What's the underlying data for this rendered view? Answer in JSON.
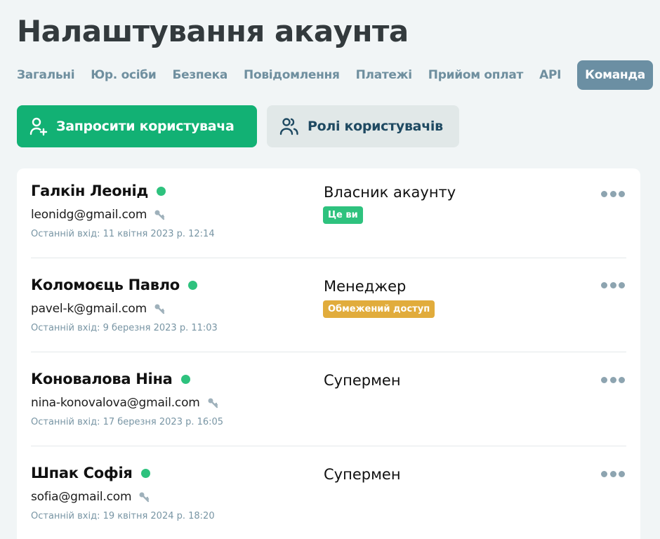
{
  "page": {
    "title": "Налаштування акаунта"
  },
  "tabs": [
    {
      "label": "Загальні",
      "active": false
    },
    {
      "label": "Юр. осіби",
      "active": false
    },
    {
      "label": "Безпека",
      "active": false
    },
    {
      "label": "Повідомлення",
      "active": false
    },
    {
      "label": "Платежі",
      "active": false
    },
    {
      "label": "Прийом оплат",
      "active": false
    },
    {
      "label": "API",
      "active": false
    },
    {
      "label": "Команда",
      "active": true
    }
  ],
  "actions": {
    "invite_label": "Запросити користувача",
    "invite_icon": "user-plus-icon",
    "roles_label": "Ролі користувачів",
    "roles_icon": "users-icon"
  },
  "colors": {
    "primary": "#12b174",
    "active_tab": "#6b8fa3",
    "online": "#2ec27e",
    "badge_self": "#2ec27e",
    "badge_limited": "#e1ac3c"
  },
  "members": [
    {
      "name": "Галкін Леонід",
      "online": true,
      "email": "leonidg@gmail.com",
      "last_login": "Останній вхід: 11 квітня 2023 р. 12:14",
      "role": "Власник акаунту",
      "badge": "Це ви",
      "badge_type": "green"
    },
    {
      "name": "Коломоєць Павло",
      "online": true,
      "email": "pavel-k@gmail.com",
      "last_login": "Останній вхід: 9 березня 2023 р. 11:03",
      "role": "Менеджер",
      "badge": "Обмежений доступ",
      "badge_type": "amber"
    },
    {
      "name": "Коновалова Ніна",
      "online": true,
      "email": "nina-konovalova@gmail.com",
      "last_login": "Останній вхід: 17 березня 2023 р. 16:05",
      "role": "Супермен",
      "badge": "",
      "badge_type": ""
    },
    {
      "name": "Шпак Софія",
      "online": true,
      "email": "sofia@gmail.com",
      "last_login": "Останній вхід: 19 квітня 2024 р. 18:20",
      "role": "Супермен",
      "badge": "",
      "badge_type": ""
    }
  ]
}
